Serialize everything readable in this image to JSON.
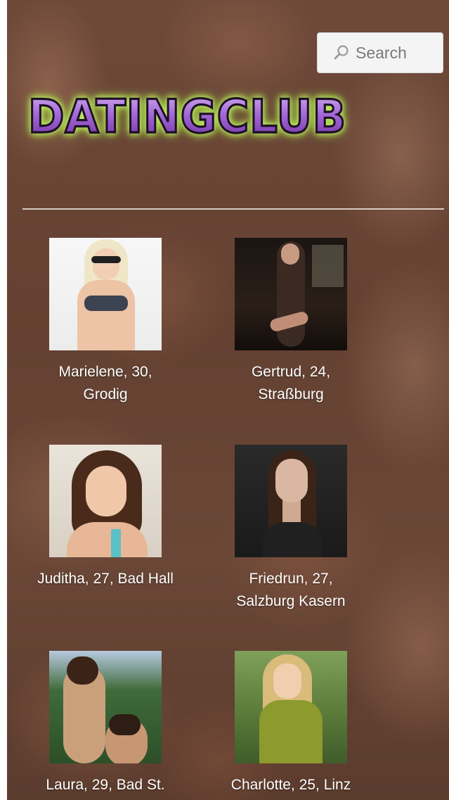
{
  "header": {
    "search_placeholder": "Search",
    "logo_text": "DATINGCLUB"
  },
  "profiles": [
    {
      "caption_line1": "Marielene, 30,",
      "caption_line2": "Grodig"
    },
    {
      "caption_line1": "Gertrud, 24,",
      "caption_line2": "Straßburg"
    },
    {
      "caption_line1": "Juditha, 27, Bad Hall",
      "caption_line2": ""
    },
    {
      "caption_line1": "Friedrun, 27,",
      "caption_line2": "Salzburg Kasern"
    },
    {
      "caption_line1": "Laura, 29, Bad St.",
      "caption_line2": ""
    },
    {
      "caption_line1": "Charlotte, 25, Linz",
      "caption_line2": ""
    }
  ],
  "colors": {
    "background": "#6b4a3a",
    "caption_text": "#ffffff",
    "logo_purple": "#9b5fd0",
    "logo_glow": "#c8f26a"
  }
}
